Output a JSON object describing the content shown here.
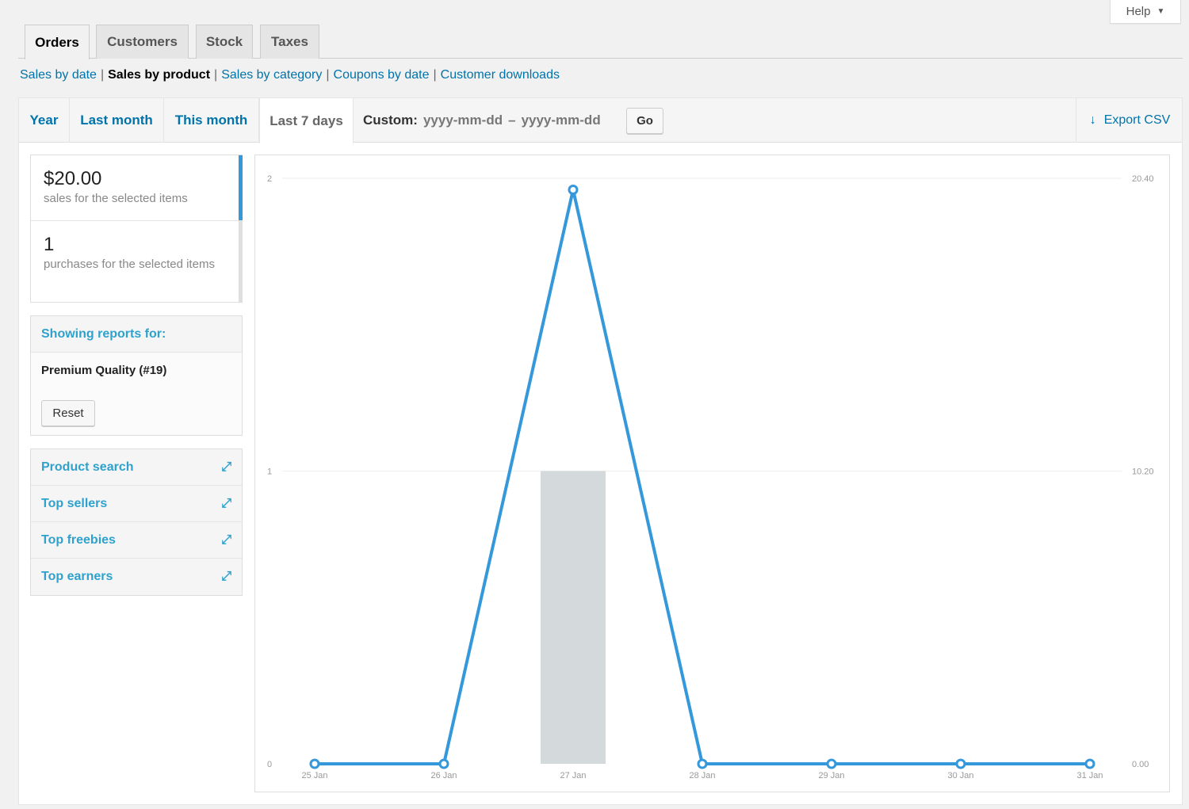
{
  "help": {
    "label": "Help",
    "icon": "triangle-down-icon"
  },
  "tabs": [
    {
      "label": "Orders",
      "active": true
    },
    {
      "label": "Customers"
    },
    {
      "label": "Stock"
    },
    {
      "label": "Taxes"
    }
  ],
  "subnav": [
    {
      "label": "Sales by date"
    },
    {
      "label": "Sales by product",
      "current": true
    },
    {
      "label": "Sales by category"
    },
    {
      "label": "Coupons by date"
    },
    {
      "label": "Customer downloads"
    }
  ],
  "ranges": [
    {
      "label": "Year"
    },
    {
      "label": "Last month"
    },
    {
      "label": "This month"
    },
    {
      "label": "Last 7 days",
      "active": true
    }
  ],
  "custom": {
    "label": "Custom:",
    "from_placeholder": "yyyy-mm-dd",
    "dash": "–",
    "to_placeholder": "yyyy-mm-dd",
    "go": "Go"
  },
  "export": {
    "label": "Export CSV",
    "icon": "download-arrow-icon"
  },
  "legend": [
    {
      "value": "$20.00",
      "label": "sales for the selected items"
    },
    {
      "value": "1",
      "label": "purchases for the selected items"
    }
  ],
  "showing": {
    "title": "Showing reports for:",
    "product": "Premium Quality (#19)",
    "reset": "Reset"
  },
  "widgets": [
    {
      "label": "Product search"
    },
    {
      "label": "Top sellers"
    },
    {
      "label": "Top freebies"
    },
    {
      "label": "Top earners"
    }
  ],
  "colors": {
    "line": "#3498db",
    "bar": "#d4d9dc",
    "link": "#0073aa"
  },
  "chart_data": {
    "type": "line",
    "categories": [
      "25 Jan",
      "26 Jan",
      "27 Jan",
      "28 Jan",
      "29 Jan",
      "30 Jan",
      "31 Jan"
    ],
    "series": [
      {
        "name": "Sales amount",
        "type": "line",
        "axis": "right",
        "values": [
          0,
          0,
          20,
          0,
          0,
          0,
          0
        ]
      },
      {
        "name": "Number of purchases",
        "type": "bar",
        "axis": "left",
        "values": [
          0,
          0,
          1,
          0,
          0,
          0,
          0
        ]
      }
    ],
    "left_ticks": [
      "0",
      "1",
      "2"
    ],
    "left_ylim": [
      0,
      2
    ],
    "right_ticks": [
      "0.00",
      "10.20",
      "20.40"
    ],
    "right_ylim": [
      0,
      20.4
    ],
    "grid": true
  }
}
